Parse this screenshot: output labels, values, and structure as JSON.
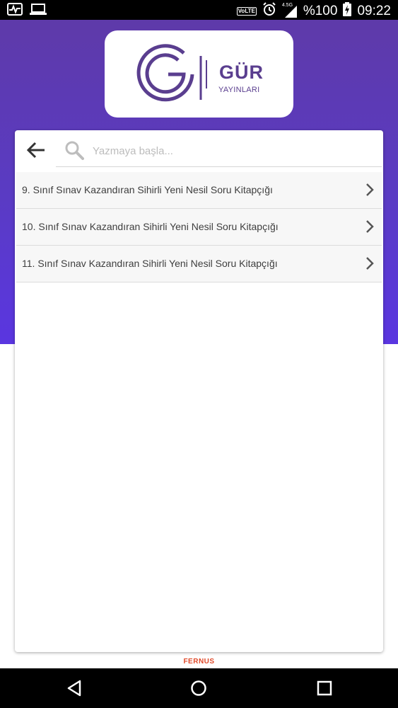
{
  "status_bar": {
    "battery": "%100",
    "time": "09:22",
    "network": "4.5G",
    "volte": "VoLTE",
    "icons": [
      "activity-icon",
      "laptop-icon",
      "volte-icon",
      "alarm-icon",
      "signal-icon",
      "battery-charging-icon"
    ]
  },
  "header": {
    "brand_name": "GÜR",
    "brand_sub": "YAYINLARI",
    "brand_color": "#5a3e8f",
    "gradient_top": "#5e3aa9",
    "gradient_bottom": "#5a36e0"
  },
  "search": {
    "placeholder": "Yazmaya başla...",
    "value": "",
    "back_icon": "arrow-left-icon",
    "search_icon": "search-icon"
  },
  "books": [
    {
      "label": "9. Sınıf Sınav Kazandıran Sihirli Yeni Nesil Soru Kitapçığı"
    },
    {
      "label": "10. Sınıf Sınav Kazandıran Sihirli Yeni Nesil Soru Kitapçığı"
    },
    {
      "label": "11. Sınıf Sınav Kazandıran Sihirli Yeni Nesil Soru Kitapçığı"
    }
  ],
  "footer": {
    "brand": "FERNUS",
    "brand_color": "#e04a2a"
  },
  "nav": {
    "back_icon": "nav-back-icon",
    "home_icon": "nav-home-icon",
    "recents_icon": "nav-recents-icon"
  }
}
